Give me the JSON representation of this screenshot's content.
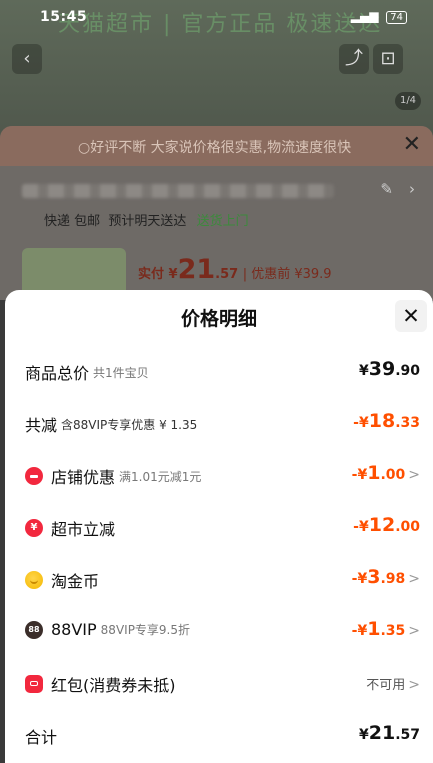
{
  "status_bar": {
    "time": "15:45",
    "battery": "74"
  },
  "background": {
    "brand": "天猫超市 | 官方正品 极速送达",
    "page_indicator": "1/4",
    "banner_text": "好评不断 大家说价格很实惠,物流速度很快",
    "shipping": [
      "快递 包邮",
      "预计明天送达"
    ],
    "shipping_highlight": "送货上门",
    "paid_label": "实付 ¥",
    "paid_int": "21",
    "paid_dec": ".57",
    "before_discount": "| 优惠前 ¥39.9"
  },
  "sheet": {
    "title": "价格明细",
    "rows": [
      {
        "label": "商品总价",
        "sub": "共1件宝贝",
        "value_prefix": "¥",
        "value_int": "39",
        "value_dec": ".90"
      },
      {
        "label": "共减",
        "sub": "含88VIP专享优惠 ¥ 1.35",
        "value_prefix": "-¥",
        "value_int": "18",
        "value_dec": ".33"
      },
      {
        "icon": "shop-coupon-icon",
        "label": "店铺优惠",
        "sub": "满1.01元减1元",
        "value_prefix": "-¥",
        "value_int": "1",
        "value_dec": ".00"
      },
      {
        "icon": "supermarket-discount-icon",
        "label": "超市立减",
        "value_prefix": "-¥",
        "value_int": "12",
        "value_dec": ".00"
      },
      {
        "icon": "taojinbi-coin-icon",
        "label": "淘金币",
        "value_prefix": "-¥",
        "value_int": "3",
        "value_dec": ".98"
      },
      {
        "icon": "88vip-icon",
        "icon_text": "88",
        "label": "88VIP",
        "sub": "88VIP专享9.5折",
        "value_prefix": "-¥",
        "value_int": "1",
        "value_dec": ".35"
      },
      {
        "icon": "red-packet-icon",
        "label": "红包(消费券未抵)",
        "value_text": "不可用"
      },
      {
        "label": "合计",
        "value_prefix": "¥",
        "value_int": "21",
        "value_dec": ".57"
      }
    ]
  },
  "colors": {
    "discount_red": "#ff4f00",
    "icon_red": "#f2283e",
    "coin_gold": "#f5b800"
  }
}
